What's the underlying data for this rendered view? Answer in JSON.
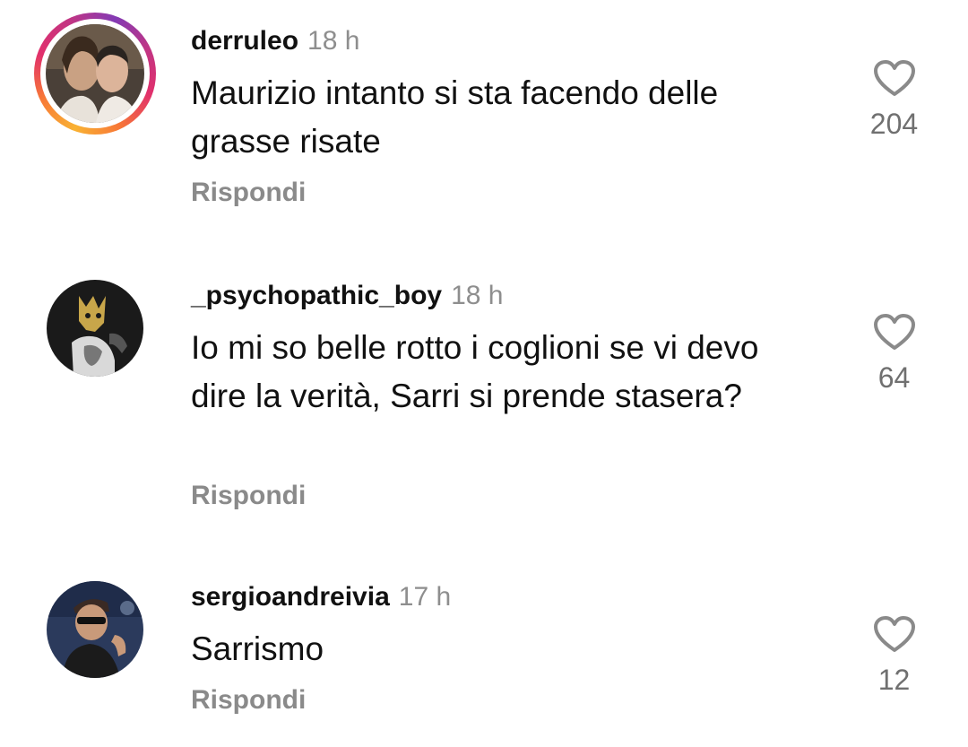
{
  "comments": [
    {
      "username": "derruleo",
      "time": "18 h",
      "text": "Maurizio intanto si sta facendo delle grasse risate",
      "reply_label": "Rispondi",
      "likes": "204",
      "has_story": true
    },
    {
      "username": "_psychopathic_boy",
      "time": "18 h",
      "text": "Io mi so belle rotto i coglioni se vi devo dire la verità, Sarri si prende stasera?",
      "reply_label": "Rispondi",
      "likes": "64",
      "has_story": false
    },
    {
      "username": "sergioandreivia",
      "time": "17 h",
      "text": "Sarrismo",
      "reply_label": "Rispondi",
      "likes": "12",
      "has_story": false
    }
  ],
  "icons": {
    "like": "heart-outline-icon"
  },
  "colors": {
    "muted": "#8e8e8e",
    "text": "#111111",
    "story_ring": [
      "#f9b233",
      "#e1306c",
      "#833ab4"
    ]
  }
}
